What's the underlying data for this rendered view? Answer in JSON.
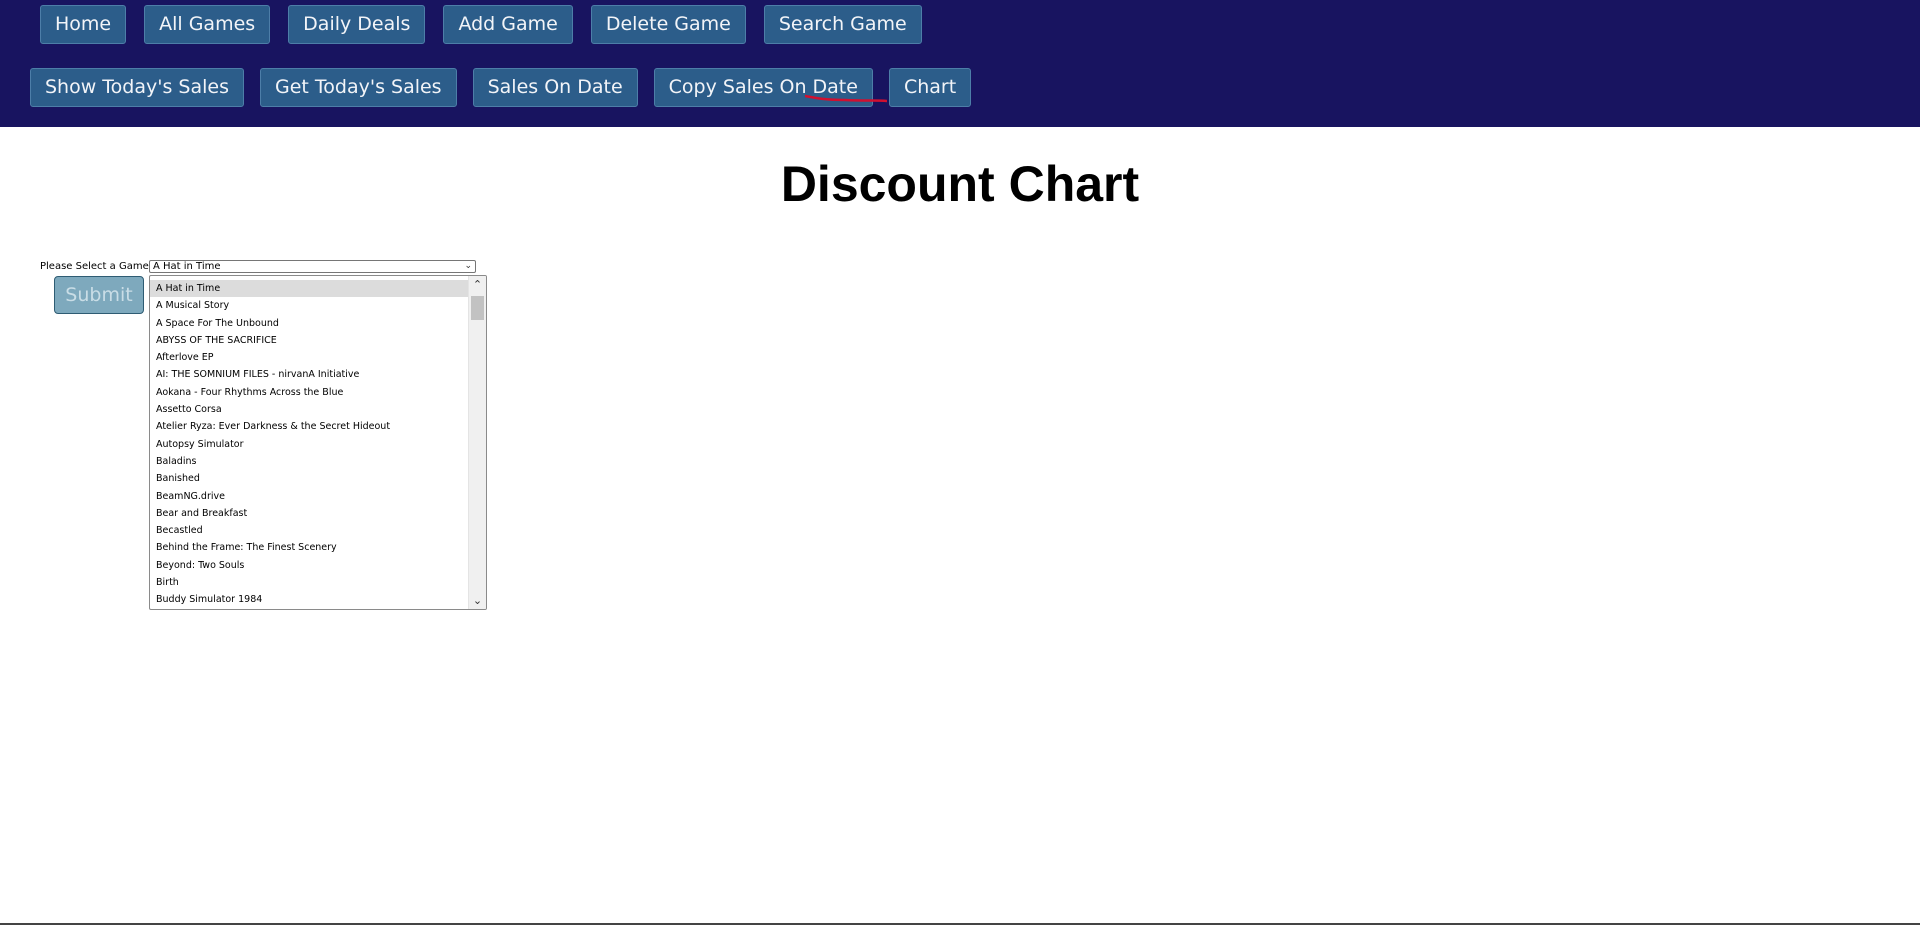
{
  "nav": {
    "row1": [
      "Home",
      "All Games",
      "Daily Deals",
      "Add Game",
      "Delete Game",
      "Search Game"
    ],
    "row2": [
      "Show Today's Sales",
      "Get Today's Sales",
      "Sales On Date",
      "Copy Sales On Date",
      "Chart"
    ]
  },
  "page": {
    "title": "Discount Chart"
  },
  "form": {
    "label": "Please Select a Game:",
    "selected": "A Hat in Time",
    "submit_label": "Submit",
    "options": [
      "A Hat in Time",
      "A Musical Story",
      "A Space For The Unbound",
      "ABYSS OF THE SACRIFICE",
      "Afterlove EP",
      "AI: THE SOMNIUM FILES - nirvanA Initiative",
      "Aokana - Four Rhythms Across the Blue",
      "Assetto Corsa",
      "Atelier Ryza: Ever Darkness & the Secret Hideout",
      "Autopsy Simulator",
      "Baladins",
      "Banished",
      "BeamNG.drive",
      "Bear and Breakfast",
      "Becastled",
      "Behind the Frame: The Finest Scenery",
      "Beyond: Two Souls",
      "Birth",
      "Buddy Simulator 1984"
    ]
  },
  "icons": {
    "select_chevron": "chevron-down-icon",
    "scroll_up": "scroll-up-arrow-icon",
    "scroll_down": "scroll-down-arrow-icon",
    "annotation": "red-underline-mark"
  },
  "colors": {
    "topbar": "#181460",
    "nav_button": "#2c5d8a",
    "submit_button": "#7ea9bd",
    "annotation": "#d01030"
  }
}
